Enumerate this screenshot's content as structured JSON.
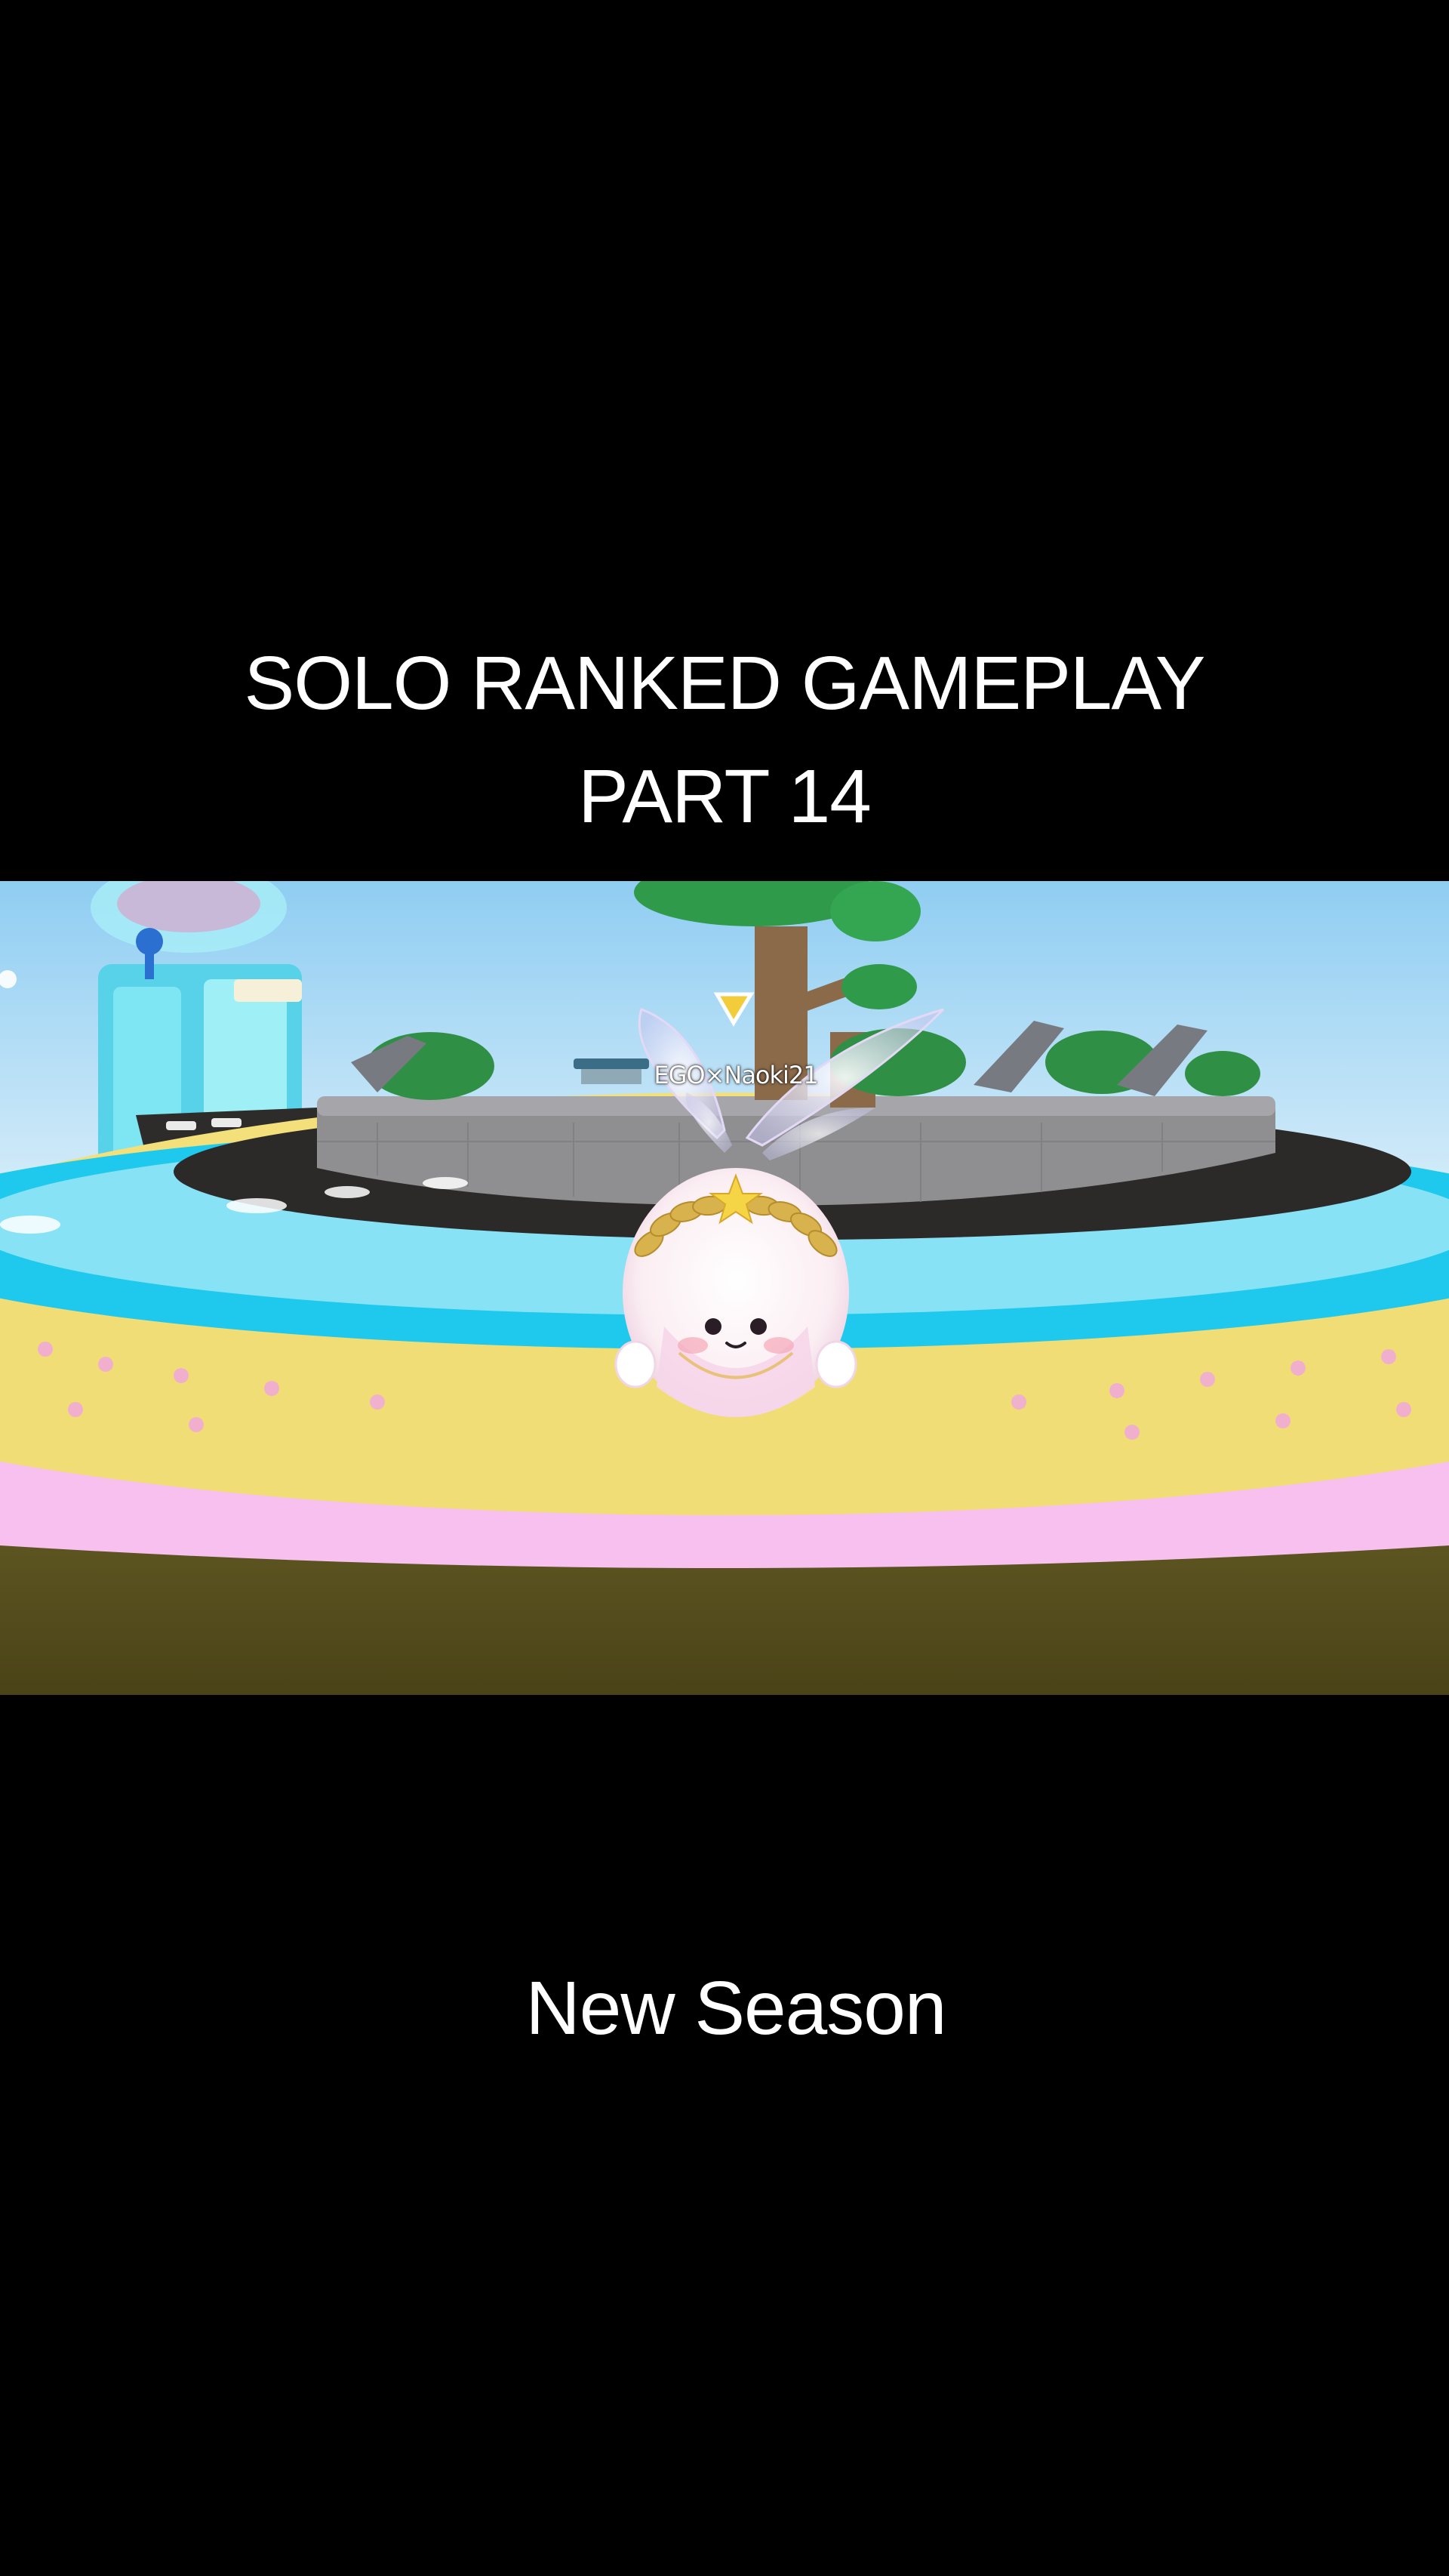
{
  "overlay": {
    "title_line1": "SOLO RANKED GAMEPLAY",
    "title_line2": "PART 14",
    "subtitle": "New Season"
  },
  "game": {
    "player_name": "EGO×Naoki21",
    "character": "fairy-puffball",
    "waypoint_icon": "triangle-marker-icon"
  },
  "colors": {
    "background": "#000000",
    "text": "#ffffff",
    "sky": "#bfe4f7",
    "yellow_ring": "#f3e07a",
    "pink_ring": "#f7c0ef",
    "cyan_water": "#1fc9ee",
    "stone_wall": "#8f8f92",
    "tree_green": "#2f9a4a",
    "waypoint": "#f2cc3a"
  }
}
